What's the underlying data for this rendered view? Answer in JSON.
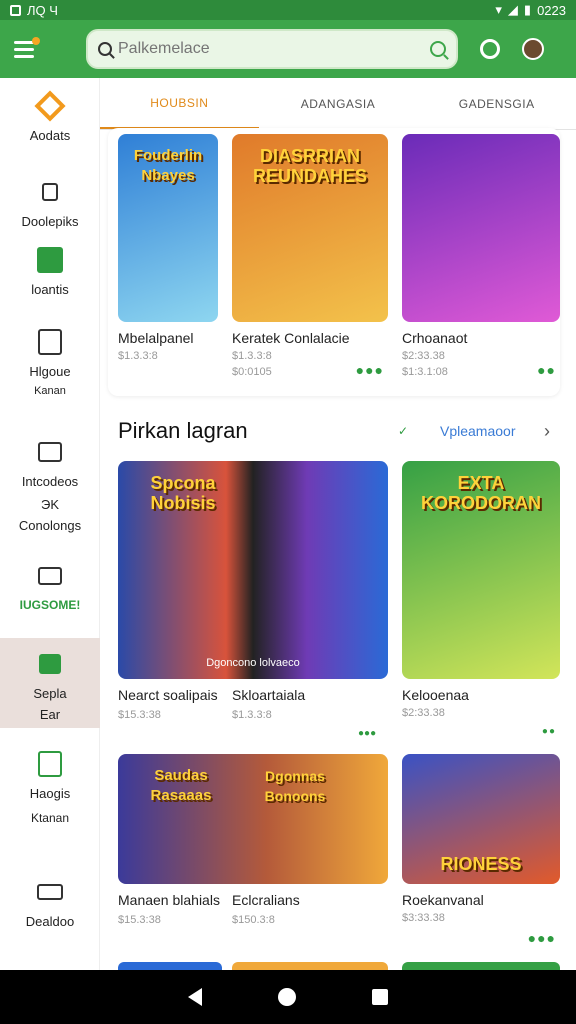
{
  "status_bar": {
    "left": "ЛQ Ч",
    "time": "0223"
  },
  "search": {
    "placeholder": "Palkemelace"
  },
  "tabs": [
    "HOUBSIN",
    "ADANGASIA",
    "GADENSGIA"
  ],
  "sidebar": [
    {
      "label": "Aodats",
      "icon": "diamond-icon"
    },
    {
      "label": "Doolepiks",
      "icon": "building-icon"
    },
    {
      "label": "loantis",
      "icon": "chart-icon"
    },
    {
      "label": "Hlgoue",
      "sub": "Kanan",
      "icon": "document-icon"
    },
    {
      "label": "Intcodeos",
      "sub": "Conolongs",
      "sub_icon_text": "ЭK",
      "icon": "folder-icon"
    },
    {
      "label": "IUGSOME!",
      "icon": "card-icon"
    },
    {
      "label": "Sepla",
      "sub": "Ear",
      "icon": "home-icon"
    },
    {
      "label": "Haogis",
      "sub": "Ktanan",
      "icon": "calendar-icon"
    },
    {
      "label": "Dealdoo",
      "icon": "toolbox-icon"
    }
  ],
  "row1": [
    {
      "art": "Fouderlin Nbayes",
      "title": "Mbelalpanel",
      "meta1": "$1.3.3:8",
      "meta2": "",
      "colors": [
        "#2f7fd6",
        "#8ed6f0"
      ]
    },
    {
      "art": "DIASRRIAN REUNDAHES",
      "title": "Keratek Conlalacie",
      "meta1": "$1.3.3:8",
      "meta2": "$0:0105",
      "colors": [
        "#e07a2a",
        "#f3c24b"
      ]
    },
    {
      "art": "",
      "title": "Crhoanaot",
      "meta1": "$2:33.38",
      "meta2": "$1:3.1:08",
      "colors": [
        "#6a2bb8",
        "#e05ad6"
      ]
    }
  ],
  "section": {
    "title": "Pirkan lagran",
    "link": "Vpleamaoor"
  },
  "row2": [
    {
      "art": "Spcona Nobisis",
      "overlay": "Dgoncono lolvaeco",
      "title": "Nearct soalipais",
      "meta1": "$15.3:38",
      "colors": [
        "#2a4aa8",
        "#d8533b"
      ]
    },
    {
      "art": "",
      "title": "Skloartaiala",
      "meta1": "$1.3.3:8",
      "colors": [
        "#6f3bb5",
        "#2a6ad6"
      ]
    },
    {
      "art": "EXTA KORODORAN",
      "title": "Kelooenaa",
      "meta1": "$2:33.38",
      "colors": [
        "#35a045",
        "#d2e55a"
      ]
    }
  ],
  "row3": [
    {
      "art": "Saudas Rasaaas",
      "title": "Manaen blahials",
      "meta1": "$15.3:38",
      "colors": [
        "#3b3a9a",
        "#f0a83a"
      ]
    },
    {
      "art": "Dgonnas Bonoons",
      "title": "Eclcralians",
      "meta1": "$150.3:8",
      "colors": [
        "#2a5ad6",
        "#f6b12a"
      ]
    },
    {
      "art": "RIONESS",
      "title": "Roekanvanal",
      "meta1": "$3:33.38",
      "colors": [
        "#3a52c4",
        "#e25a2a"
      ]
    }
  ],
  "colors": {
    "primary": "#3da64a",
    "accent": "#e08a1a"
  }
}
